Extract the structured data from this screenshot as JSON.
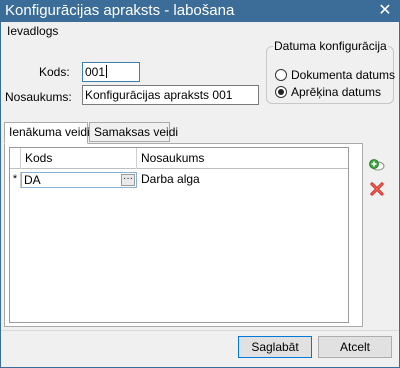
{
  "window": {
    "title": "Konfigurācijas apraksts - labošana",
    "close_glyph": "✕"
  },
  "menu": {
    "label": "Ievadlogs"
  },
  "form": {
    "kods_label": "Kods:",
    "kods_value": "001",
    "nosaukums_label": "Nosaukums:",
    "nosaukums_value": "Konfigurācijas apraksts 001"
  },
  "datuma": {
    "legend": "Datuma konfigurācija",
    "options": [
      {
        "label": "Dokumenta datums",
        "checked": false
      },
      {
        "label": "Aprēķina datums",
        "checked": true
      }
    ]
  },
  "tabs": [
    {
      "label": "Ienākuma veidi",
      "active": true
    },
    {
      "label": "Samaksas veidi",
      "active": false
    }
  ],
  "grid": {
    "columns": [
      "Kods",
      "Nosaukums"
    ],
    "rows": [
      {
        "indicator": "*",
        "kods": "DA",
        "nosaukums": "Darba alga"
      }
    ],
    "ellipsis": "···"
  },
  "icons": {
    "add": "add-row-icon",
    "delete": "delete-row-icon"
  },
  "colors": {
    "titlebar": "#3b6d98",
    "accent": "#0078d7",
    "delete": "#d0312d",
    "add": "#3aa33a"
  },
  "buttons": {
    "save": "Saglabāt",
    "cancel": "Atcelt"
  }
}
